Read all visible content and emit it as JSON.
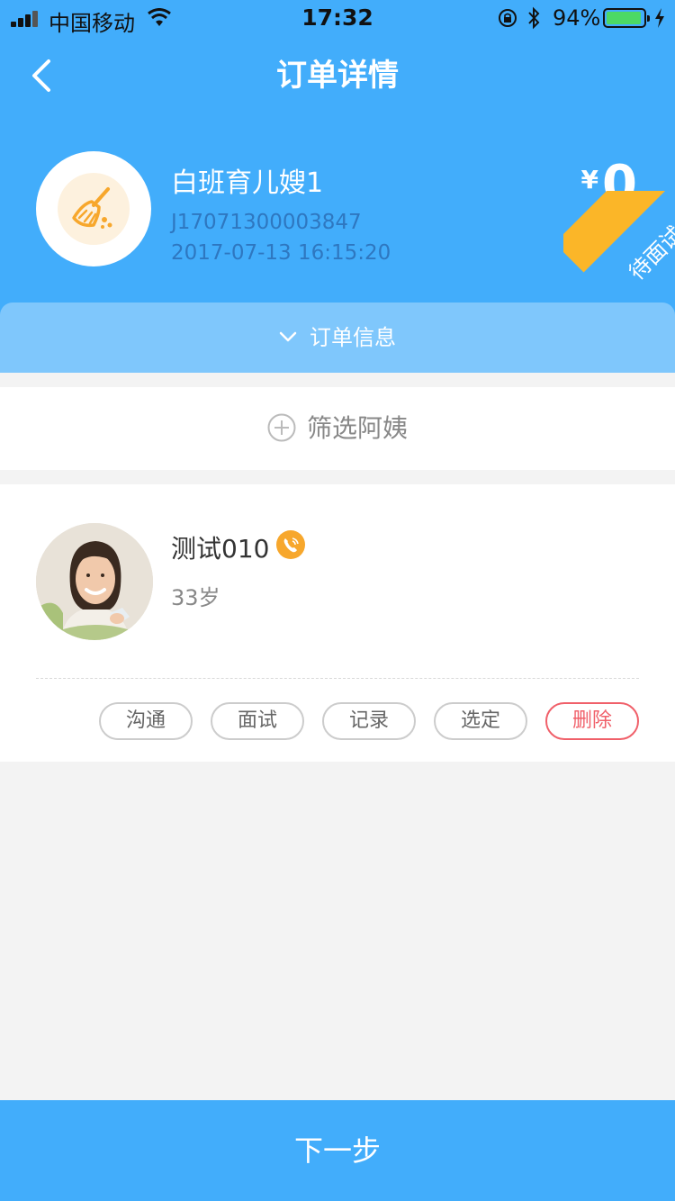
{
  "status_bar": {
    "carrier": "中国移动",
    "time": "17:32",
    "battery_text": "94%",
    "battery_level": 0.94
  },
  "nav": {
    "title": "订单详情",
    "back_icon": "chevron-left-icon"
  },
  "order": {
    "service_name": "白班育儿嫂1",
    "order_number": "J17071300003847",
    "created_at": "2017-07-13 16:15:20",
    "currency": "¥",
    "price": "0",
    "status": "待面试",
    "service_icon": "broom-icon",
    "info_label": "订单信息"
  },
  "filter": {
    "label": "筛选阿姨"
  },
  "candidate": {
    "name": "测试010",
    "age": "33岁",
    "actions": {
      "communicate": "沟通",
      "interview": "面试",
      "record": "记录",
      "select": "选定",
      "delete": "删除"
    }
  },
  "footer": {
    "next_label": "下一步"
  },
  "colors": {
    "primary": "#42adfb",
    "info_bar": "#7fc7fc",
    "ribbon": "#fbb628",
    "danger": "#f0606a",
    "phone_badge": "#f7a72c"
  }
}
